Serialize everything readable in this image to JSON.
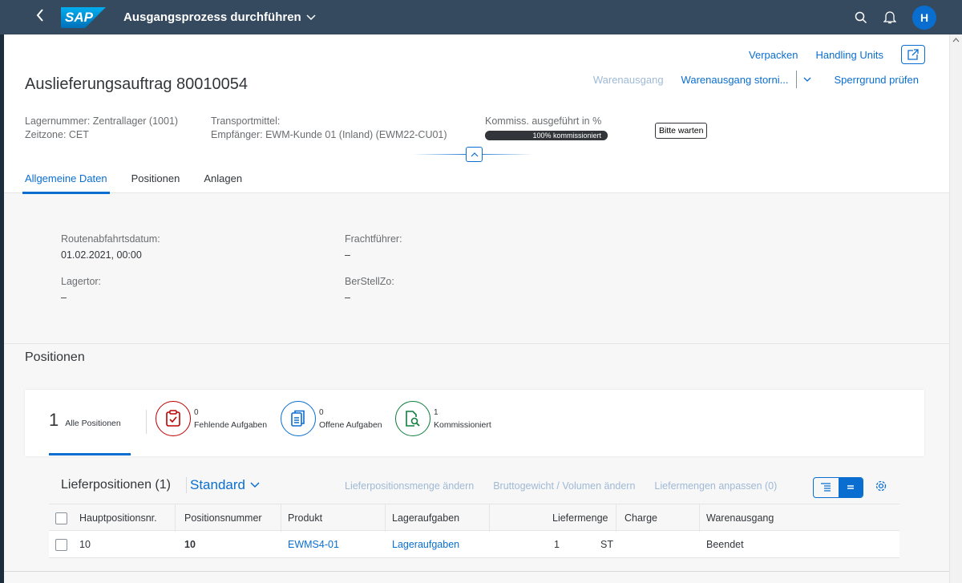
{
  "shell": {
    "app_title": "Ausgangsprozess durchführen",
    "logo_text": "SAP",
    "avatar_initial": "H"
  },
  "header": {
    "top_actions": [
      "Verpacken",
      "Handling Units"
    ],
    "title": "Auslieferungsauftrag 80010054",
    "actions": {
      "goods_issue": "Warenausgang",
      "cancel_goods_issue": "Warenausgang storni...",
      "check_block": "Sperrgrund prüfen"
    },
    "attributes": {
      "warehouse": "Lagernummer: Zentrallager (1001)",
      "timezone": "Zeitzone: CET",
      "transport": "Transportmittel:",
      "recipient": "Empfänger: EWM-Kunde 01 (Inland) (EWM22-CU01)",
      "picking_label": "Kommiss. ausgeführt in %",
      "picking_progress_text": "100% kommissioniert",
      "picking_percent": 100,
      "wait_button": "Bitte warten"
    },
    "tabs": [
      "Allgemeine Daten",
      "Positionen",
      "Anlagen"
    ]
  },
  "general": {
    "route_departure_label": "Routenabfahrtsdatum:",
    "route_departure_value": "01.02.2021, 00:00",
    "carrier_label": "Frachtführer:",
    "carrier_value": "–",
    "gate_label": "Lagertor:",
    "gate_value": "–",
    "staging_label": "BerStellZo:",
    "staging_value": "–"
  },
  "positions": {
    "section_title": "Positionen",
    "icon_tabs": {
      "all_count": "1",
      "all_label": "Alle Positionen",
      "missing_count": "0",
      "missing_label": "Fehlende Aufgaben",
      "open_count": "0",
      "open_label": "Offene Aufgaben",
      "picked_count": "1",
      "picked_label": "Kommissioniert"
    },
    "table_title": "Lieferpositionen (1)",
    "variant": "Standard",
    "toolbar_actions": [
      "Lieferpositionsmenge ändern",
      "Bruttogewicht / Volumen ändern",
      "Liefermengen anpassen (0)"
    ],
    "columns": [
      "Hauptpositionsnr.",
      "Positionsnummer",
      "Produkt",
      "Lageraufgaben",
      "Liefermenge",
      "Charge",
      "Warenausgang"
    ],
    "rows": [
      {
        "main_pos": "10",
        "pos_num": "10",
        "product": "EWMS4-01",
        "tasks": "Lageraufgaben",
        "qty": "1",
        "unit": "ST",
        "batch": "",
        "goods_issue": "Beendet"
      }
    ]
  },
  "colors": {
    "shell": "#354a5f",
    "accent": "#0a6ed1",
    "negative": "#bb0000",
    "positive": "#107e3e"
  }
}
